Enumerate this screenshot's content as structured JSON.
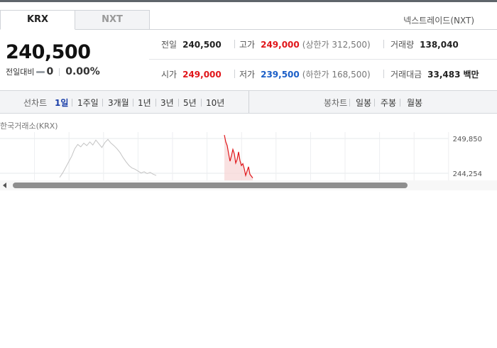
{
  "market_tabs": [
    {
      "label": "KRX",
      "active": true
    },
    {
      "label": "NXT",
      "active": false
    }
  ],
  "nxt_link": "넥스트레이드(NXT)",
  "current_price": "240,500",
  "change": {
    "label": "전일대비",
    "value": "0",
    "percent": "0.00%"
  },
  "quote": {
    "prev_close": {
      "label": "전일",
      "value": "240,500"
    },
    "high": {
      "label": "고가",
      "value": "249,000",
      "limit_label": "상한가",
      "limit_value": "312,500"
    },
    "volume": {
      "label": "거래량",
      "value": "138,040"
    },
    "open": {
      "label": "시가",
      "value": "249,000"
    },
    "low": {
      "label": "저가",
      "value": "239,500",
      "limit_label": "하한가",
      "limit_value": "168,500"
    },
    "amount": {
      "label": "거래대금",
      "value": "33,483",
      "unit": "백만"
    }
  },
  "colors": {
    "up": "#e0161a",
    "down": "#1a5ec7",
    "active_period": "#1a3ea8"
  },
  "toolbar": {
    "line_chart_title": "선차트",
    "periods": [
      "1일",
      "1주일",
      "3개월",
      "1년",
      "3년",
      "5년",
      "10년"
    ],
    "active_period": "1일",
    "candle_chart_title": "봉차트",
    "candle_periods": [
      "일봉",
      "주봉",
      "월봉"
    ]
  },
  "source_label": "한국거래소(KRX)",
  "chart_data": {
    "type": "line",
    "y_ticks": [
      "249,850",
      "244,254"
    ],
    "y_tick_values": [
      249850,
      244254
    ],
    "series": [
      {
        "values": [
          243600,
          244300,
          245200,
          246100,
          247000,
          248200,
          248900,
          248500,
          249100,
          248700,
          249300,
          248800,
          249600,
          249000,
          248400,
          249200,
          249700,
          249100,
          248700,
          248200,
          247600,
          246800,
          246100,
          245500,
          245100,
          244900,
          244600,
          244300,
          244500,
          244200,
          244400,
          244100,
          243900
        ]
      },
      {
        "values": [
          250400,
          249300,
          248700,
          247400,
          246200,
          247100,
          248100,
          247400,
          245900,
          246500,
          247700,
          246300,
          245500,
          245800,
          245000,
          243900,
          244600,
          245300,
          244100,
          243800,
          243500
        ]
      }
    ],
    "grid": true
  }
}
